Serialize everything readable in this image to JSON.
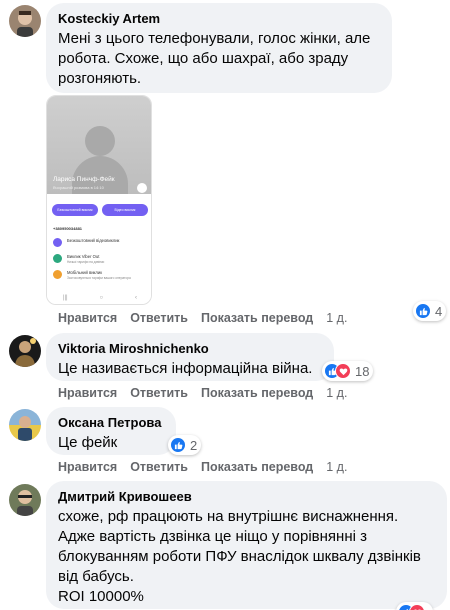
{
  "actions": {
    "like": "Нравится",
    "reply": "Ответить",
    "show_translation": "Показать перевод"
  },
  "colors": {
    "like": "#1877f2",
    "love": "#f33e58",
    "bubble": "#f0f2f5",
    "viber": "#7360f2"
  },
  "comments": [
    {
      "author": "Kosteckiy Artem",
      "lines": [
        "Мені з цього телефонували, голос жінки, але",
        "робота. Схоже, що або шахраї, або зраду",
        "розгоняють."
      ],
      "time": "1 д.",
      "reactions": {
        "types": [
          "like"
        ],
        "count": "4"
      },
      "screenshot": {
        "contact_name": "Лариса Пинчф-Фейк",
        "contact_sub": "Вчорашній розмова в 14:10",
        "button_left": "Безкоштовний виклик",
        "button_right": "Відео виклик",
        "phone": "+380950034881",
        "rows": [
          {
            "title": "Безкоштовний відеовиклик",
            "sub": "",
            "color": "#7360f2"
          },
          {
            "title": "Виклик Viber Out",
            "sub": "Низькі тарифи на дзвінки",
            "color": "#2ca87f"
          },
          {
            "title": "Мобільний виклик",
            "sub": "Застосовуються тарифи вашого оператора",
            "color": "#f0a030"
          }
        ]
      }
    },
    {
      "author": "Viktoria Miroshnichenko",
      "lines": [
        "Це називається інформаційна війна."
      ],
      "time": "1 д.",
      "reactions": {
        "types": [
          "like",
          "love"
        ],
        "count": "18"
      }
    },
    {
      "author": "Оксана Петрова",
      "lines": [
        "Це фейк"
      ],
      "time": "1 д.",
      "reactions": {
        "types": [
          "like"
        ],
        "count": "2"
      }
    },
    {
      "author": "Дмитрий Кривошеев",
      "lines": [
        "схоже, рф працюють на внутрішнє виснажнення.",
        "Адже вартість дзвінка це ніщо у порівнянні з",
        "блокуванням роботи ПФУ внаслідок шквалу дзвінків",
        "від бабусь.",
        "ROI 10000%"
      ],
      "time": "",
      "reactions": {
        "types": [
          "like",
          "love"
        ],
        "count": ""
      }
    }
  ]
}
